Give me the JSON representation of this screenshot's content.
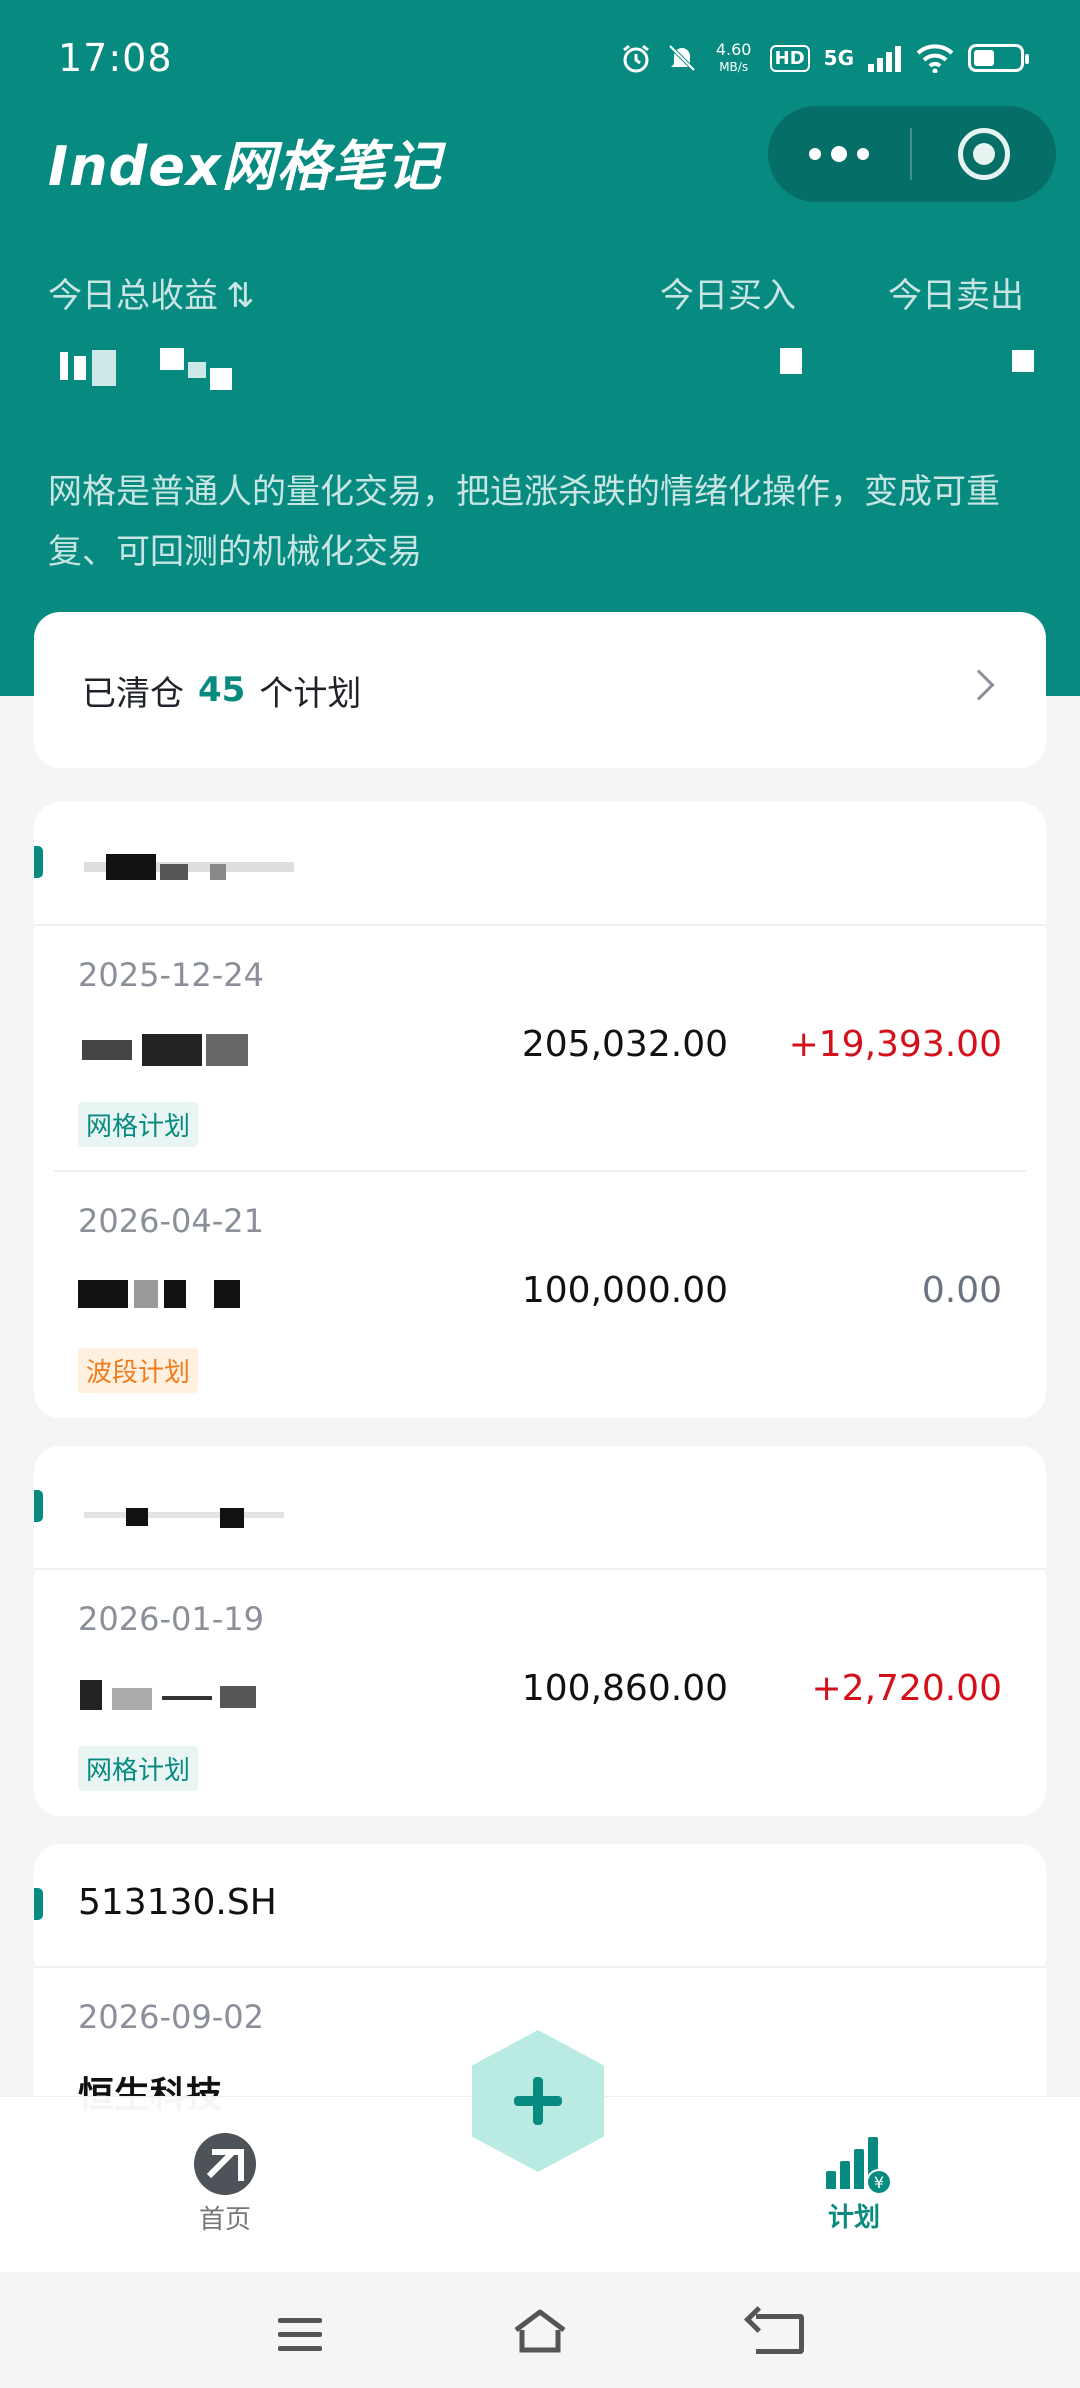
{
  "status": {
    "time": "17:08",
    "net_speed": "4.60",
    "net_speed_unit": "MB/s",
    "hd_badge": "HD",
    "network": "5G",
    "icons": [
      "alarm-icon",
      "mute-icon",
      "signal-icon",
      "wifi-icon",
      "battery-icon"
    ]
  },
  "app": {
    "title": "Index网格笔记"
  },
  "summary": {
    "total_profit_label": "今日总收益",
    "buy_label": "今日买入",
    "sell_label": "今日卖出",
    "sort_icon": "⇅"
  },
  "intro": "网格是普通人的量化交易，把追涨杀跌的情绪化操作，变成可重复、可回测的机械化交易",
  "cleared": {
    "prefix": "已清仓",
    "count": "45",
    "suffix": "个计划"
  },
  "groups": [
    {
      "rows": [
        {
          "date": "2025-12-24",
          "amount": "205,032.00",
          "profit": "+19,393.00",
          "tag": "网格计划"
        },
        {
          "date": "2026-04-21",
          "amount": "100,000.00",
          "profit": "0.00",
          "tag": "波段计划"
        }
      ]
    },
    {
      "rows": [
        {
          "date": "2026-01-19",
          "amount": "100,860.00",
          "profit": "+2,720.00",
          "tag": "网格计划"
        }
      ]
    },
    {
      "title": "513130.SH",
      "rows": [
        {
          "date": "2026-09-02",
          "name": "恒生科技"
        }
      ]
    }
  ],
  "tabbar": {
    "home_label": "首页",
    "plan_label": "计划"
  },
  "colors": {
    "brand": "#078a80",
    "profit_positive": "#d4111b",
    "tag_grid": "#078a80",
    "tag_swing": "#f07c1c"
  }
}
